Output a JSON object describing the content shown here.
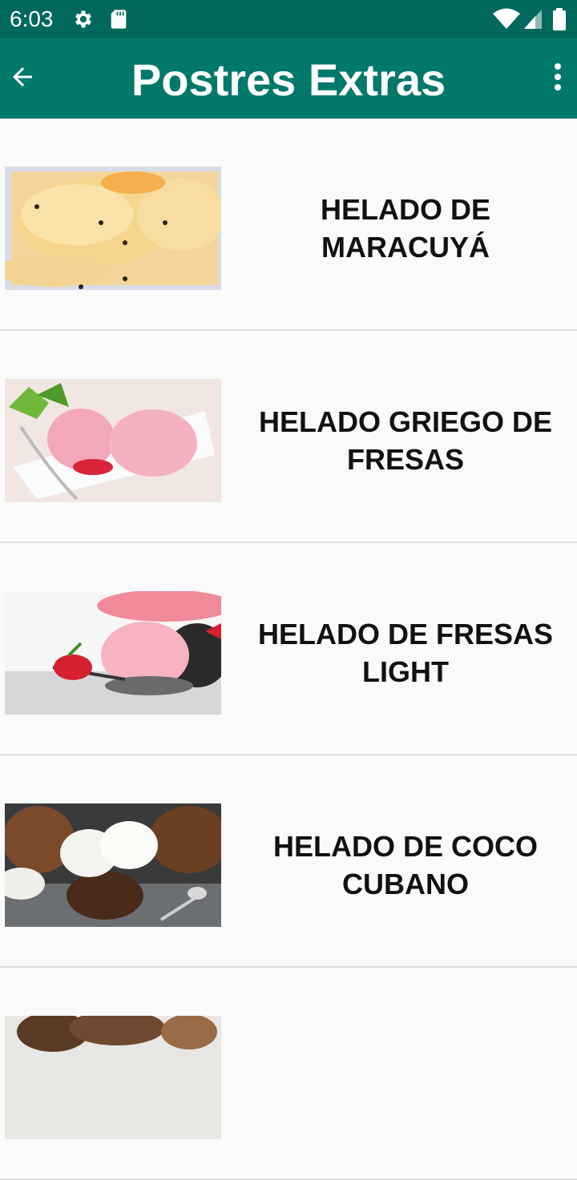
{
  "status_bar": {
    "time": "6:03",
    "left_icons": [
      "gear-icon",
      "sd-card-icon"
    ],
    "right_icons": [
      "wifi-icon",
      "signal-icon",
      "battery-icon"
    ]
  },
  "app_bar": {
    "title": "Postres Extras",
    "back_icon": "arrow-left-icon",
    "menu_icon": "more-vert-icon",
    "background": "#00796b",
    "status_background": "#00695c"
  },
  "items": [
    {
      "title": "HELADO DE MARACUYÁ",
      "image": "passion-fruit-ice-cream-photo"
    },
    {
      "title": "HELADO GRIEGO DE FRESAS",
      "image": "greek-strawberry-ice-cream-photo"
    },
    {
      "title": "HELADO DE FRESAS LIGHT",
      "image": "light-strawberry-ice-cream-photo"
    },
    {
      "title": "HELADO DE COCO CUBANO",
      "image": "cuban-coconut-ice-cream-photo"
    },
    {
      "title": "",
      "image": "coconut-dessert-photo"
    }
  ]
}
